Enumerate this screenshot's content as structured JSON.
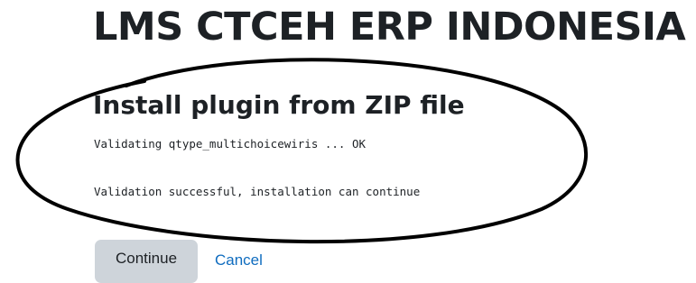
{
  "site": {
    "title": "LMS CTCEH ERP INDONESIA"
  },
  "page": {
    "heading": "Install plugin from ZIP file"
  },
  "validation_log": {
    "lines": [
      "Validating qtype_multichoicewiris ... OK",
      "Validation successful, installation can continue"
    ]
  },
  "actions": {
    "continue_label": "Continue",
    "cancel_label": "Cancel"
  },
  "colors": {
    "text": "#1d2125",
    "link": "#0f6cbf",
    "button_bg": "#ced4da",
    "annotation": "#000000"
  }
}
